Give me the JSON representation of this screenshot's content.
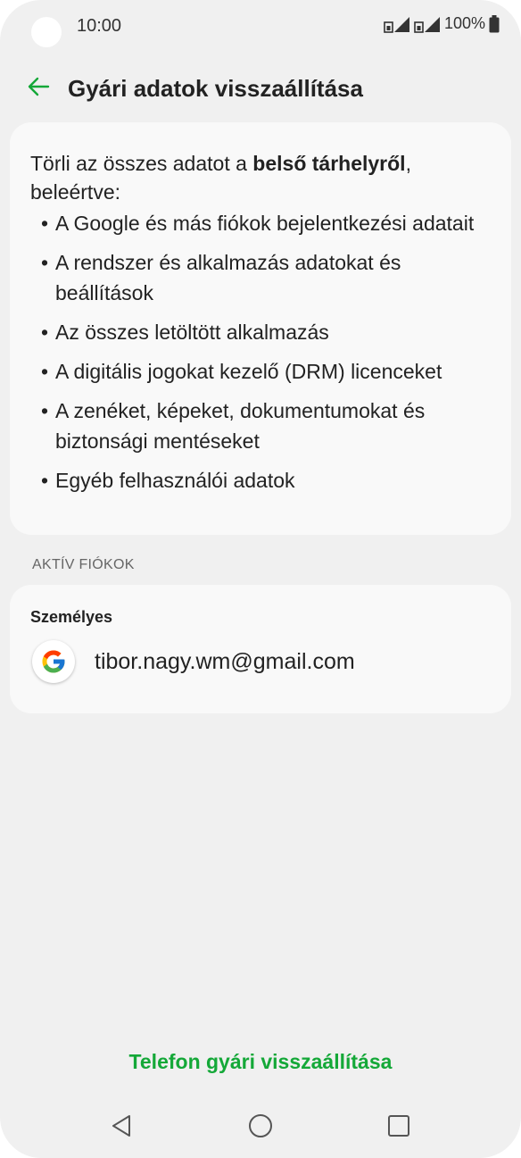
{
  "status_bar": {
    "time": "10:00",
    "battery": "100%",
    "icons": [
      "sim-signal-icon",
      "sim-signal-icon",
      "battery-icon"
    ]
  },
  "header": {
    "back_icon": "arrow-left-icon",
    "title": "Gyári adatok visszaállítása"
  },
  "info": {
    "intro_prefix": "Törli az összes adatot a ",
    "intro_bold": "belső tárhelyről",
    "intro_suffix": ", beleértve:",
    "bullets": [
      "A Google és más fiókok bejelentkezési adatait",
      "A rendszer és alkalmazás adatokat és beállítások",
      "Az összes letöltött alkalmazás",
      "A digitális jogokat kezelő (DRM) licenceket",
      "A zenéket, képeket, dokumentumokat és biztonsági mentéseket",
      "Egyéb felhasználói adatok"
    ]
  },
  "accounts": {
    "section_label": "AKTÍV FIÓKOK",
    "group_label": "Személyes",
    "items": [
      {
        "icon": "google-logo-icon",
        "email": "tibor.nagy.wm@gmail.com"
      }
    ]
  },
  "action": {
    "label": "Telefon gyári visszaállítása",
    "color": "#14a838"
  },
  "navbar": {
    "icons": [
      "nav-back-icon",
      "nav-home-icon",
      "nav-recents-icon"
    ]
  },
  "colors": {
    "accent": "#14a838",
    "background": "#f0f0f0",
    "card": "#f9f9f9"
  }
}
